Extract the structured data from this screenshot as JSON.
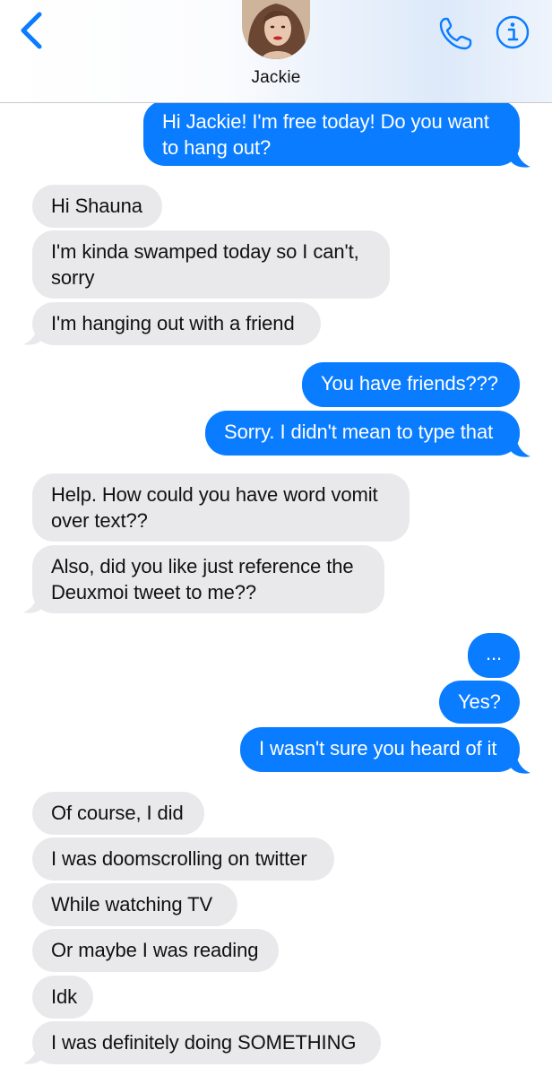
{
  "header": {
    "contact_name": "Jackie"
  },
  "icons": {
    "back": "chevron-left-icon",
    "phone": "phone-icon",
    "info": "info-icon"
  },
  "colors": {
    "outgoing_bubble": "#0a7cff",
    "incoming_bubble": "#e9e9eb",
    "accent": "#0a7cff"
  },
  "messages": [
    {
      "from": "me",
      "text": "Hi Jackie! I'm free today! Do you want to hang out?"
    },
    {
      "from": "them",
      "text": "Hi Shauna"
    },
    {
      "from": "them",
      "text": "I'm kinda swamped today so I can't, sorry"
    },
    {
      "from": "them",
      "text": "I'm hanging out with a friend"
    },
    {
      "from": "me",
      "text": "You have friends???"
    },
    {
      "from": "me",
      "text": "Sorry. I didn't mean to type that"
    },
    {
      "from": "them",
      "text": "Help. How could you have word vomit over text??"
    },
    {
      "from": "them",
      "text": "Also, did you like just reference the Deuxmoi tweet to me??"
    },
    {
      "from": "me",
      "text": "..."
    },
    {
      "from": "me",
      "text": "Yes?"
    },
    {
      "from": "me",
      "text": "I wasn't sure you heard of it"
    },
    {
      "from": "them",
      "text": "Of course, I did"
    },
    {
      "from": "them",
      "text": "I was doomscrolling on twitter"
    },
    {
      "from": "them",
      "text": "While watching TV"
    },
    {
      "from": "them",
      "text": "Or maybe I was reading"
    },
    {
      "from": "them",
      "text": "Idk"
    },
    {
      "from": "them",
      "text": "I was definitely doing SOMETHING"
    }
  ]
}
